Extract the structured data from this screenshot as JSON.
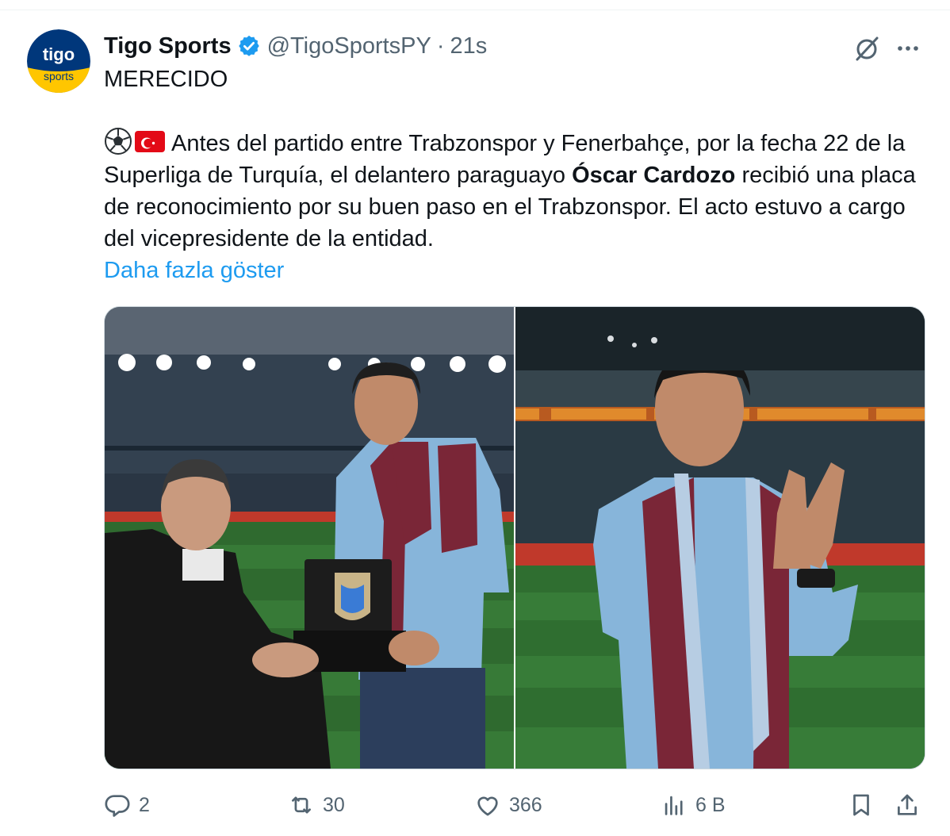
{
  "tweet": {
    "author_name": "Tigo Sports",
    "handle": "@TigoSportsPY",
    "separator": "·",
    "time": "21s",
    "headline": "MERECIDO",
    "body_before_bold": "Antes del partido entre Trabzonspor y Fenerbahçe, por la fecha 22 de la Superliga de Turquía, el delantero paraguayo ",
    "body_bold": "Óscar Cardozo",
    "body_after_bold": " recibió una placa de reconocimiento por su buen paso en el Trabzonspor. El acto estuvo a cargo del vicepresidente de la entidad.",
    "show_more": "Daha fazla göster"
  },
  "avatar": {
    "logo_text": "tigo",
    "sub_text": "sports"
  },
  "icons": {
    "verified": "verified-badge-icon",
    "grok": "grok-icon",
    "more": "more-options-icon",
    "soccer_ball": "soccer-ball-emoji",
    "flag": "turkey-flag-emoji",
    "reply": "reply-icon",
    "retweet": "retweet-icon",
    "like": "like-icon",
    "views": "views-icon",
    "bookmark": "bookmark-icon",
    "share": "share-icon"
  },
  "actions": {
    "replies": "2",
    "retweets": "30",
    "likes": "366",
    "views": "6 B"
  },
  "colors": {
    "accent": "#1d9bf0",
    "muted": "#536471",
    "text": "#0f1419",
    "brand_blue": "#00377b",
    "brand_yellow": "#ffc600"
  }
}
